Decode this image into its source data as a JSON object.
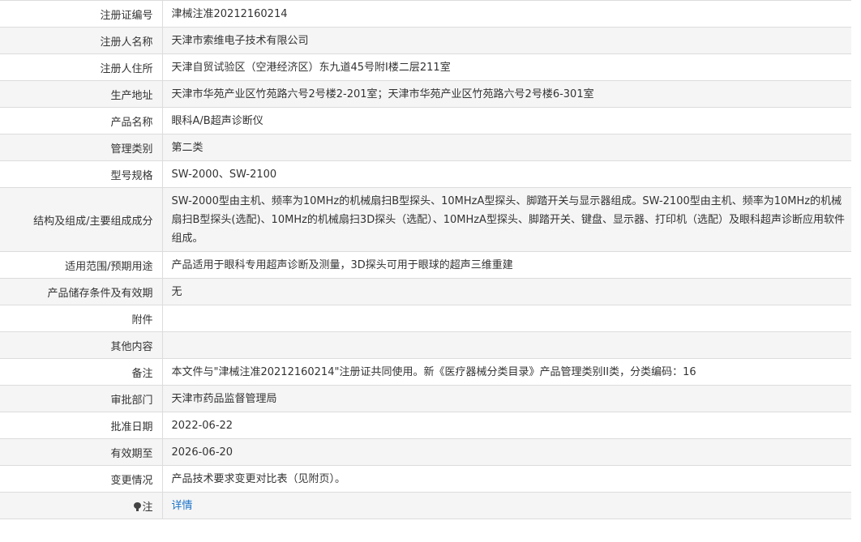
{
  "rows": [
    {
      "label": "注册证编号",
      "value": "津械注准20212160214"
    },
    {
      "label": "注册人名称",
      "value": "天津市索维电子技术有限公司"
    },
    {
      "label": "注册人住所",
      "value": "天津自贸试验区（空港经济区）东九道45号附I楼二层211室"
    },
    {
      "label": "生产地址",
      "value": "天津市华苑产业区竹苑路六号2号楼2-201室；天津市华苑产业区竹苑路六号2号楼6-301室"
    },
    {
      "label": "产品名称",
      "value": "眼科A/B超声诊断仪"
    },
    {
      "label": "管理类别",
      "value": "第二类"
    },
    {
      "label": "型号规格",
      "value": "SW-2000、SW-2100"
    },
    {
      "label": "结构及组成/主要组成成分",
      "value": "SW-2000型由主机、频率为10MHz的机械扇扫B型探头、10MHzA型探头、脚踏开关与显示器组成。SW-2100型由主机、频率为10MHz的机械扇扫B型探头(选配)、10MHz的机械扇扫3D探头（选配）、10MHzA型探头、脚踏开关、键盘、显示器、打印机（选配）及眼科超声诊断应用软件组成。"
    },
    {
      "label": "适用范围/预期用途",
      "value": "产品适用于眼科专用超声诊断及测量，3D探头可用于眼球的超声三维重建"
    },
    {
      "label": "产品储存条件及有效期",
      "value": "无"
    },
    {
      "label": "附件",
      "value": ""
    },
    {
      "label": "其他内容",
      "value": ""
    },
    {
      "label": "备注",
      "value": "本文件与\"津械注准20212160214\"注册证共同使用。新《医疗器械分类目录》产品管理类别II类，分类编码：16"
    },
    {
      "label": "审批部门",
      "value": "天津市药品监督管理局"
    },
    {
      "label": "批准日期",
      "value": "2022-06-22"
    },
    {
      "label": "有效期至",
      "value": "2026-06-20"
    },
    {
      "label": "变更情况",
      "value": "产品技术要求变更对比表（见附页）。"
    }
  ],
  "note": {
    "label": "注",
    "icon": "bulb-icon",
    "link_text": "详情",
    "link_color": "#1a73c8"
  }
}
